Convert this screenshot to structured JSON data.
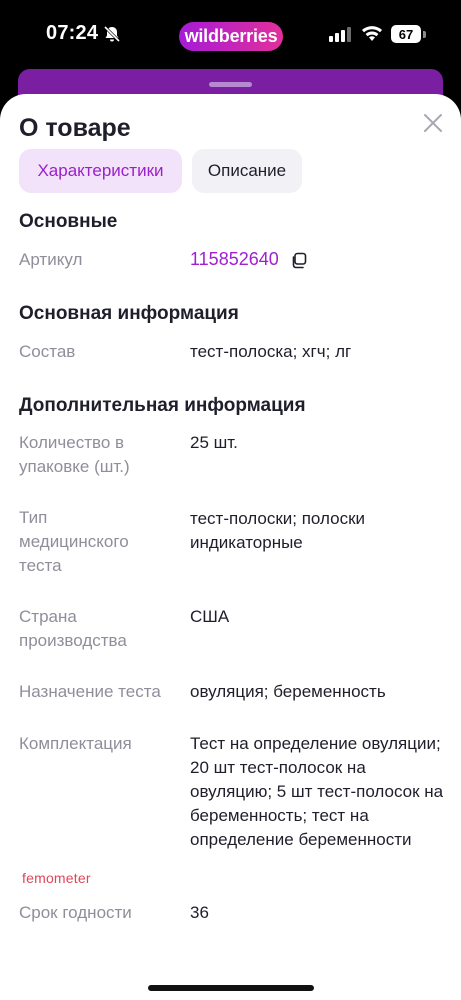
{
  "status_bar": {
    "time": "07:24",
    "app_pill": "wildberries",
    "battery": "67"
  },
  "sheet": {
    "title": "О товаре",
    "tabs": [
      {
        "label": "Характеристики",
        "active": true
      },
      {
        "label": "Описание",
        "active": false
      }
    ],
    "sections": [
      {
        "title": "Основные",
        "rows": [
          {
            "label": "Артикул",
            "value": "115852640"
          }
        ]
      },
      {
        "title": "Основная информация",
        "rows": [
          {
            "label": "Состав",
            "value": "тест-полоска; хгч; лг"
          }
        ]
      },
      {
        "title": "Дополнительная информация",
        "rows": [
          {
            "label": "Количество в упаковке (шт.)",
            "value": "25 шт."
          },
          {
            "label": "Тип медицинского теста",
            "value": "тест-полоски; полоски индикаторные"
          },
          {
            "label": "Страна производства",
            "value": "США"
          },
          {
            "label": "Назначение теста",
            "value": "овуляция; беременность"
          },
          {
            "label": "Комплектация",
            "value": "Тест на определение овуляции; 20 шт тест-полосок на овуляцию; 5 шт тест-полосок на беременность; тест на определение беременности"
          },
          {
            "label": "Срок годности",
            "value": "36"
          }
        ]
      }
    ],
    "brand_logo_text": "femometer"
  },
  "colors": {
    "accent": "#a020d0",
    "tab_active_bg": "#f3e3fa",
    "label_gray": "#8f8e9a",
    "brand": "#e0455b"
  }
}
